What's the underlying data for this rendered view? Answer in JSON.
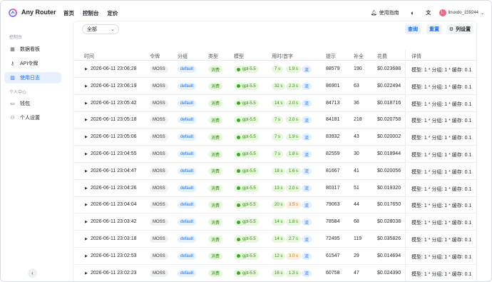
{
  "app": {
    "title": "Any Router"
  },
  "topnav": [
    "首页",
    "控制台",
    "定价"
  ],
  "topright": {
    "guide_label": "使用指南",
    "username": "linuxdo_159244",
    "avatar_letter": "L"
  },
  "sidebar": {
    "group1": "控制台",
    "items1": [
      {
        "label": "数据看板",
        "icon": "dashboard-icon"
      },
      {
        "label": "API令牌",
        "icon": "key-icon"
      },
      {
        "label": "使用日志",
        "icon": "chart-icon"
      }
    ],
    "group2": "个人中心",
    "items2": [
      {
        "label": "钱包",
        "icon": "wallet-icon"
      },
      {
        "label": "个人设置",
        "icon": "user-icon"
      }
    ]
  },
  "filters": {
    "select_value": "全部",
    "query_label": "查询",
    "reset_label": "重置",
    "columns_label": "列设置"
  },
  "columns": [
    "时间",
    "令牌",
    "分组",
    "类型",
    "模型",
    "用时/首字",
    "提示",
    "补全",
    "花费",
    "详情"
  ],
  "rows": [
    {
      "time": "2026-06-11 23:06:28",
      "token": "MOSS",
      "group": "default",
      "type": "消费",
      "model": "gpt-5.5",
      "dur": "7 s",
      "first": "1.9 s",
      "first_slow": false,
      "stream": "流",
      "prompt": "88579",
      "completion": "190",
      "cost": "$0.023688",
      "detail": "模型: 1 * 分组: 1 * 缓存: 0.1"
    },
    {
      "time": "2026-06-11 23:06:19",
      "token": "MOSS",
      "group": "default",
      "type": "消费",
      "model": "gpt-5.5",
      "dur": "32 s",
      "first": "2.3 s",
      "first_slow": false,
      "stream": "流",
      "prompt": "86901",
      "completion": "63",
      "cost": "$0.022494",
      "detail": "模型: 1 * 分组: 1 * 缓存: 0.1"
    },
    {
      "time": "2026-06-11 23:05:42",
      "token": "MOSS",
      "group": "default",
      "type": "消费",
      "model": "gpt-5.5",
      "dur": "14 s",
      "first": "2.0 s",
      "first_slow": false,
      "stream": "流",
      "prompt": "84713",
      "completion": "36",
      "cost": "$0.018716",
      "detail": "模型: 1 * 分组: 1 * 缓存: 0.1"
    },
    {
      "time": "2026-06-11 23:05:18",
      "token": "MOSS",
      "group": "default",
      "type": "消费",
      "model": "gpt-5.5",
      "dur": "7 s",
      "first": "2.0 s",
      "first_slow": false,
      "stream": "流",
      "prompt": "84181",
      "completion": "218",
      "cost": "$0.020758",
      "detail": "模型: 1 * 分组: 1 * 缓存: 0.1"
    },
    {
      "time": "2026-06-11 23:05:06",
      "token": "MOSS",
      "group": "default",
      "type": "消费",
      "model": "gpt-5.5",
      "dur": "7 s",
      "first": "1.9 s",
      "first_slow": false,
      "stream": "流",
      "prompt": "83932",
      "completion": "43",
      "cost": "$0.020002",
      "detail": "模型: 1 * 分组: 1 * 缓存: 0.1"
    },
    {
      "time": "2026-06-11 23:04:55",
      "token": "MOSS",
      "group": "default",
      "type": "消费",
      "model": "gpt-5.5",
      "dur": "7 s",
      "first": "1.8 s",
      "first_slow": false,
      "stream": "流",
      "prompt": "82559",
      "completion": "30",
      "cost": "$0.018944",
      "detail": "模型: 1 * 分组: 1 * 缓存: 0.1"
    },
    {
      "time": "2026-06-11 23:04:47",
      "token": "MOSS",
      "group": "default",
      "type": "消费",
      "model": "gpt-5.5",
      "dur": "18 s",
      "first": "1.6 s",
      "first_slow": false,
      "stream": "流",
      "prompt": "81667",
      "completion": "41",
      "cost": "$0.020056",
      "detail": "模型: 1 * 分组: 1 * 缓存: 0.1"
    },
    {
      "time": "2026-06-11 23:04:26",
      "token": "MOSS",
      "group": "default",
      "type": "消费",
      "model": "gpt-5.5",
      "dur": "13 s",
      "first": "2.0 s",
      "first_slow": false,
      "stream": "流",
      "prompt": "80317",
      "completion": "51",
      "cost": "$0.019320",
      "detail": "模型: 1 * 分组: 1 * 缓存: 0.1"
    },
    {
      "time": "2026-06-11 23:04:04",
      "token": "MOSS",
      "group": "default",
      "type": "消费",
      "model": "gpt-5.5",
      "dur": "20 s",
      "first": "3.5 s",
      "first_slow": true,
      "stream": "流",
      "prompt": "79063",
      "completion": "44",
      "cost": "$0.017650",
      "detail": "模型: 1 * 分组: 1 * 缓存: 0.1"
    },
    {
      "time": "2026-06-11 23:03:42",
      "token": "MOSS",
      "group": "default",
      "type": "消费",
      "model": "gpt-5.5",
      "dur": "14 s",
      "first": "1.8 s",
      "first_slow": false,
      "stream": "流",
      "prompt": "78584",
      "completion": "68",
      "cost": "$0.028038",
      "detail": "模型: 1 * 分组: 1 * 缓存: 0.1"
    },
    {
      "time": "2026-06-11 23:03:18",
      "token": "MOSS",
      "group": "default",
      "type": "消费",
      "model": "gpt-5.5",
      "dur": "14 s",
      "first": "2.7 s",
      "first_slow": false,
      "stream": "流",
      "prompt": "72495",
      "completion": "119",
      "cost": "$0.035826",
      "detail": "模型: 1 * 分组: 1 * 缓存: 0.1"
    },
    {
      "time": "2026-06-11 23:02:53",
      "token": "MOSS",
      "group": "default",
      "type": "消费",
      "model": "gpt-5.5",
      "dur": "12 s",
      "first": "3.0 s",
      "first_slow": true,
      "stream": "流",
      "prompt": "61547",
      "completion": "29",
      "cost": "$0.014694",
      "detail": "模型: 1 * 分组: 1 * 缓存: 0.1"
    },
    {
      "time": "2026-06-11 23:02:23",
      "token": "MOSS",
      "group": "default",
      "type": "消费",
      "model": "gpt-5.5",
      "dur": "16 s",
      "first": "1.3 s",
      "first_slow": false,
      "stream": "流",
      "prompt": "60758",
      "completion": "47",
      "cost": "$0.024390",
      "detail": "模型: 1 * 分组: 1 * 缓存: 0.1"
    }
  ]
}
